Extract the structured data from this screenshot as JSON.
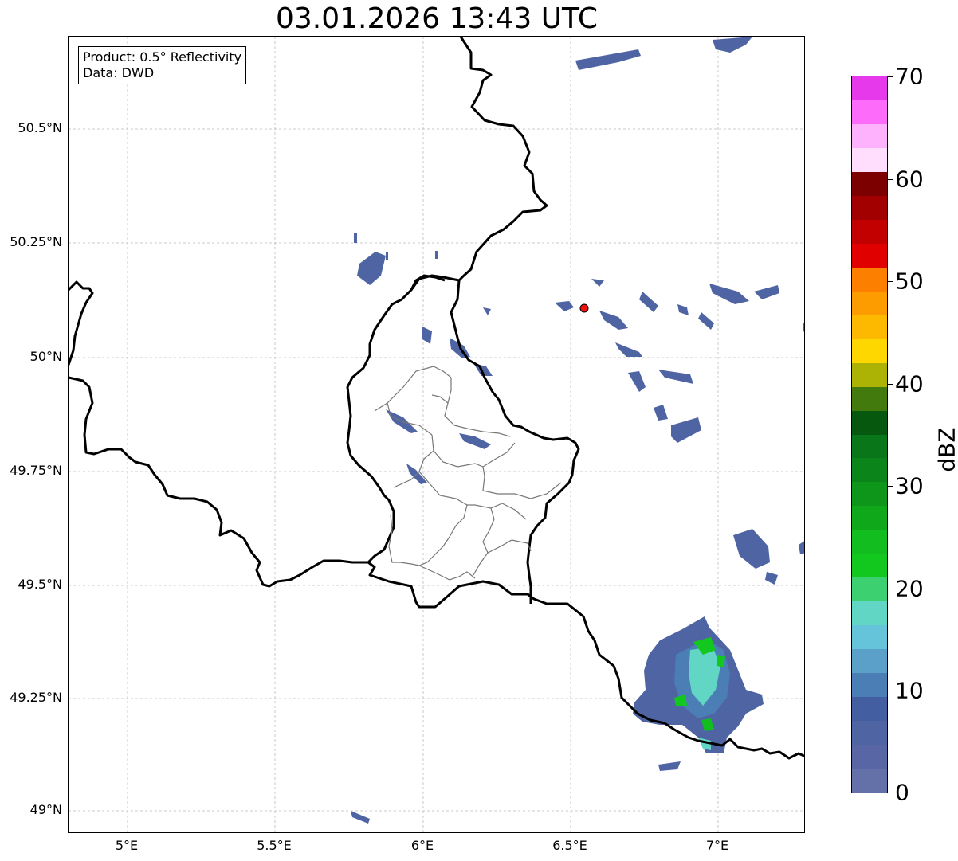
{
  "title": "03.01.2026 13:43 UTC",
  "info_box": {
    "product": "Product: 0.5° Reflectivity",
    "data_source": "Data: DWD"
  },
  "latitude_labels": [
    "50.5°N",
    "50.25°N",
    "50°N",
    "49.75°N",
    "49.5°N",
    "49.25°N",
    "49°N"
  ],
  "longitude_labels": [
    "5°E",
    "5.5°E",
    "6°E",
    "6.5°E",
    "7°E"
  ],
  "colorbar": {
    "unit": "dBZ",
    "ticks": [
      "70",
      "60",
      "50",
      "40",
      "30",
      "20",
      "10",
      "0"
    ],
    "range": [
      0,
      70
    ],
    "segments": [
      "#6470a8",
      "#5866a5",
      "#4f64a3",
      "#445ea2",
      "#4c7eb6",
      "#5aa0c8",
      "#65c3da",
      "#62d6c4",
      "#3dd070",
      "#12c81f",
      "#12bd1f",
      "#10a81b",
      "#0e961a",
      "#0b851a",
      "#0a761a",
      "#06580e",
      "#437a0d",
      "#adb305",
      "#fed600",
      "#fdb900",
      "#fd9c00",
      "#fd7f00",
      "#e00000",
      "#c20000",
      "#a20000",
      "#7c0000",
      "#ffdefd",
      "#feb1fd",
      "#fd6bfb",
      "#e739ec"
    ]
  },
  "colors": {
    "radar_low": "#4f64a3",
    "radar_mid": "#62d6c4",
    "radar_high": "#12c81f",
    "station_marker": "#ee1111",
    "border_major": "#000000",
    "border_minor": "#777777"
  },
  "station_marker": {
    "lon": 6.55,
    "lat": 50.12
  }
}
